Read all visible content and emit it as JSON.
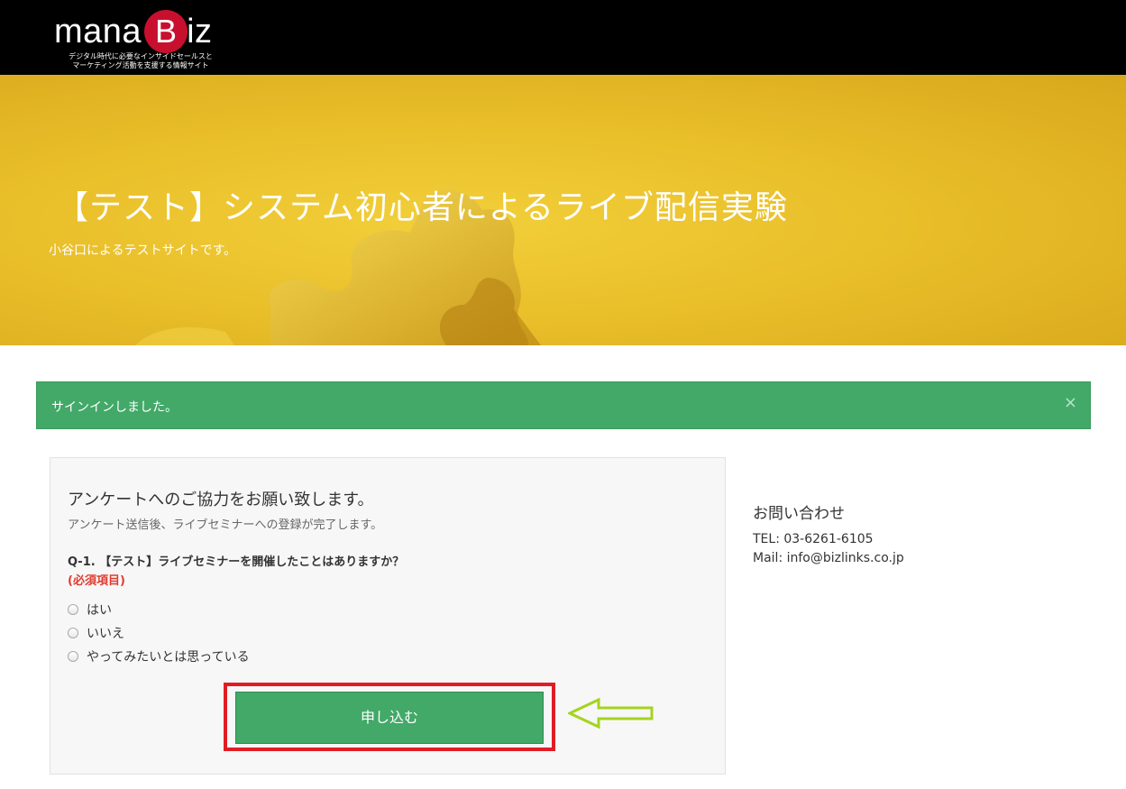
{
  "header": {
    "logo_prefix": "mana",
    "logo_badge": "B",
    "logo_suffix": "iz",
    "tagline_line1": "デジタル時代に必要なインサイドセールスと",
    "tagline_line2": "マーケティング活動を支援する情報サイト"
  },
  "hero": {
    "title": "【テスト】システム初心者によるライブ配信実験",
    "subtitle": "小谷口によるテストサイトです。"
  },
  "alert": {
    "message": "サインインしました。",
    "close": "×"
  },
  "form": {
    "title": "アンケートへのご協力をお願い致します。",
    "description": "アンケート送信後、ライブセミナーへの登録が完了します。",
    "question": "Q-1. 【テスト】ライブセミナーを開催したことはありますか？",
    "required_label": "(必須項目)",
    "options": [
      "はい",
      "いいえ",
      "やってみたいとは思っている"
    ],
    "submit_label": "申し込む"
  },
  "contact": {
    "title": "お問い合わせ",
    "tel": "TEL: 03-6261-6105",
    "mail": "Mail: info@bizlinks.co.jp"
  },
  "colors": {
    "accent_green": "#42a968",
    "highlight_red": "#e11d24",
    "arrow_green": "#a4d41e",
    "hero_yellow": "#e9bf2a"
  }
}
